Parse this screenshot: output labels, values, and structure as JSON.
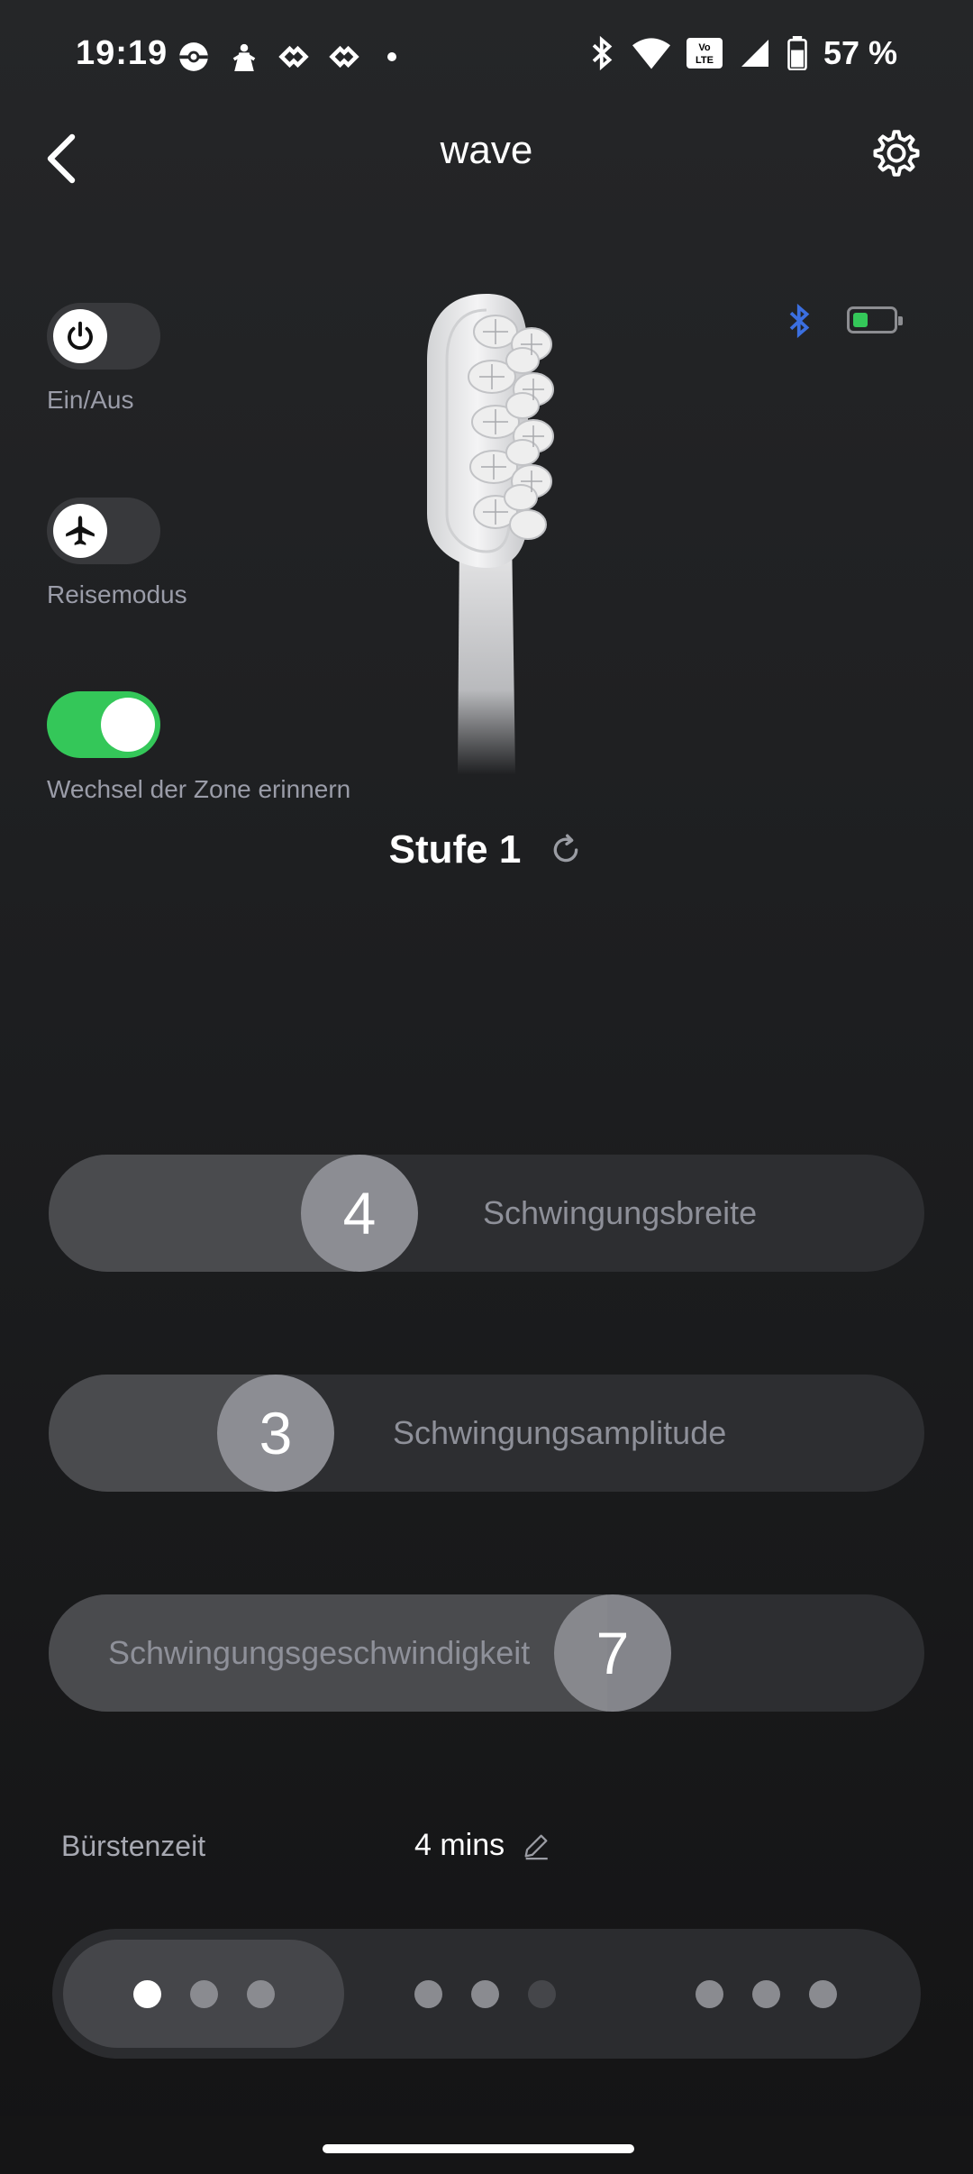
{
  "status_bar": {
    "time": "19:19",
    "battery_percent": "57 %",
    "volte_label": "Vo LTE"
  },
  "header": {
    "title": "wave"
  },
  "toggles": [
    {
      "label": "Ein/Aus",
      "on": false,
      "icon": "power-icon"
    },
    {
      "label": "Reisemodus",
      "on": false,
      "icon": "airplane-icon"
    },
    {
      "label": "Wechsel der Zone erinnern",
      "on": true
    }
  ],
  "device": {
    "battery_level": 0.25,
    "battery_color": "#34c759",
    "bluetooth_color": "#3b6fe0"
  },
  "level": {
    "text": "Stufe 1"
  },
  "sliders": [
    {
      "label": "Schwingungsbreite",
      "value": "4"
    },
    {
      "label": "Schwingungsamplitude",
      "value": "3"
    },
    {
      "label": "Schwingungsgeschwindigkeit",
      "value": "7"
    }
  ],
  "brushing_time": {
    "label": "Bürstenzeit",
    "value": "4 mins"
  },
  "modes": {
    "selected_index": 0,
    "count": 3
  },
  "colors": {
    "accent_green": "#34c759",
    "background": "#1d1e20"
  }
}
